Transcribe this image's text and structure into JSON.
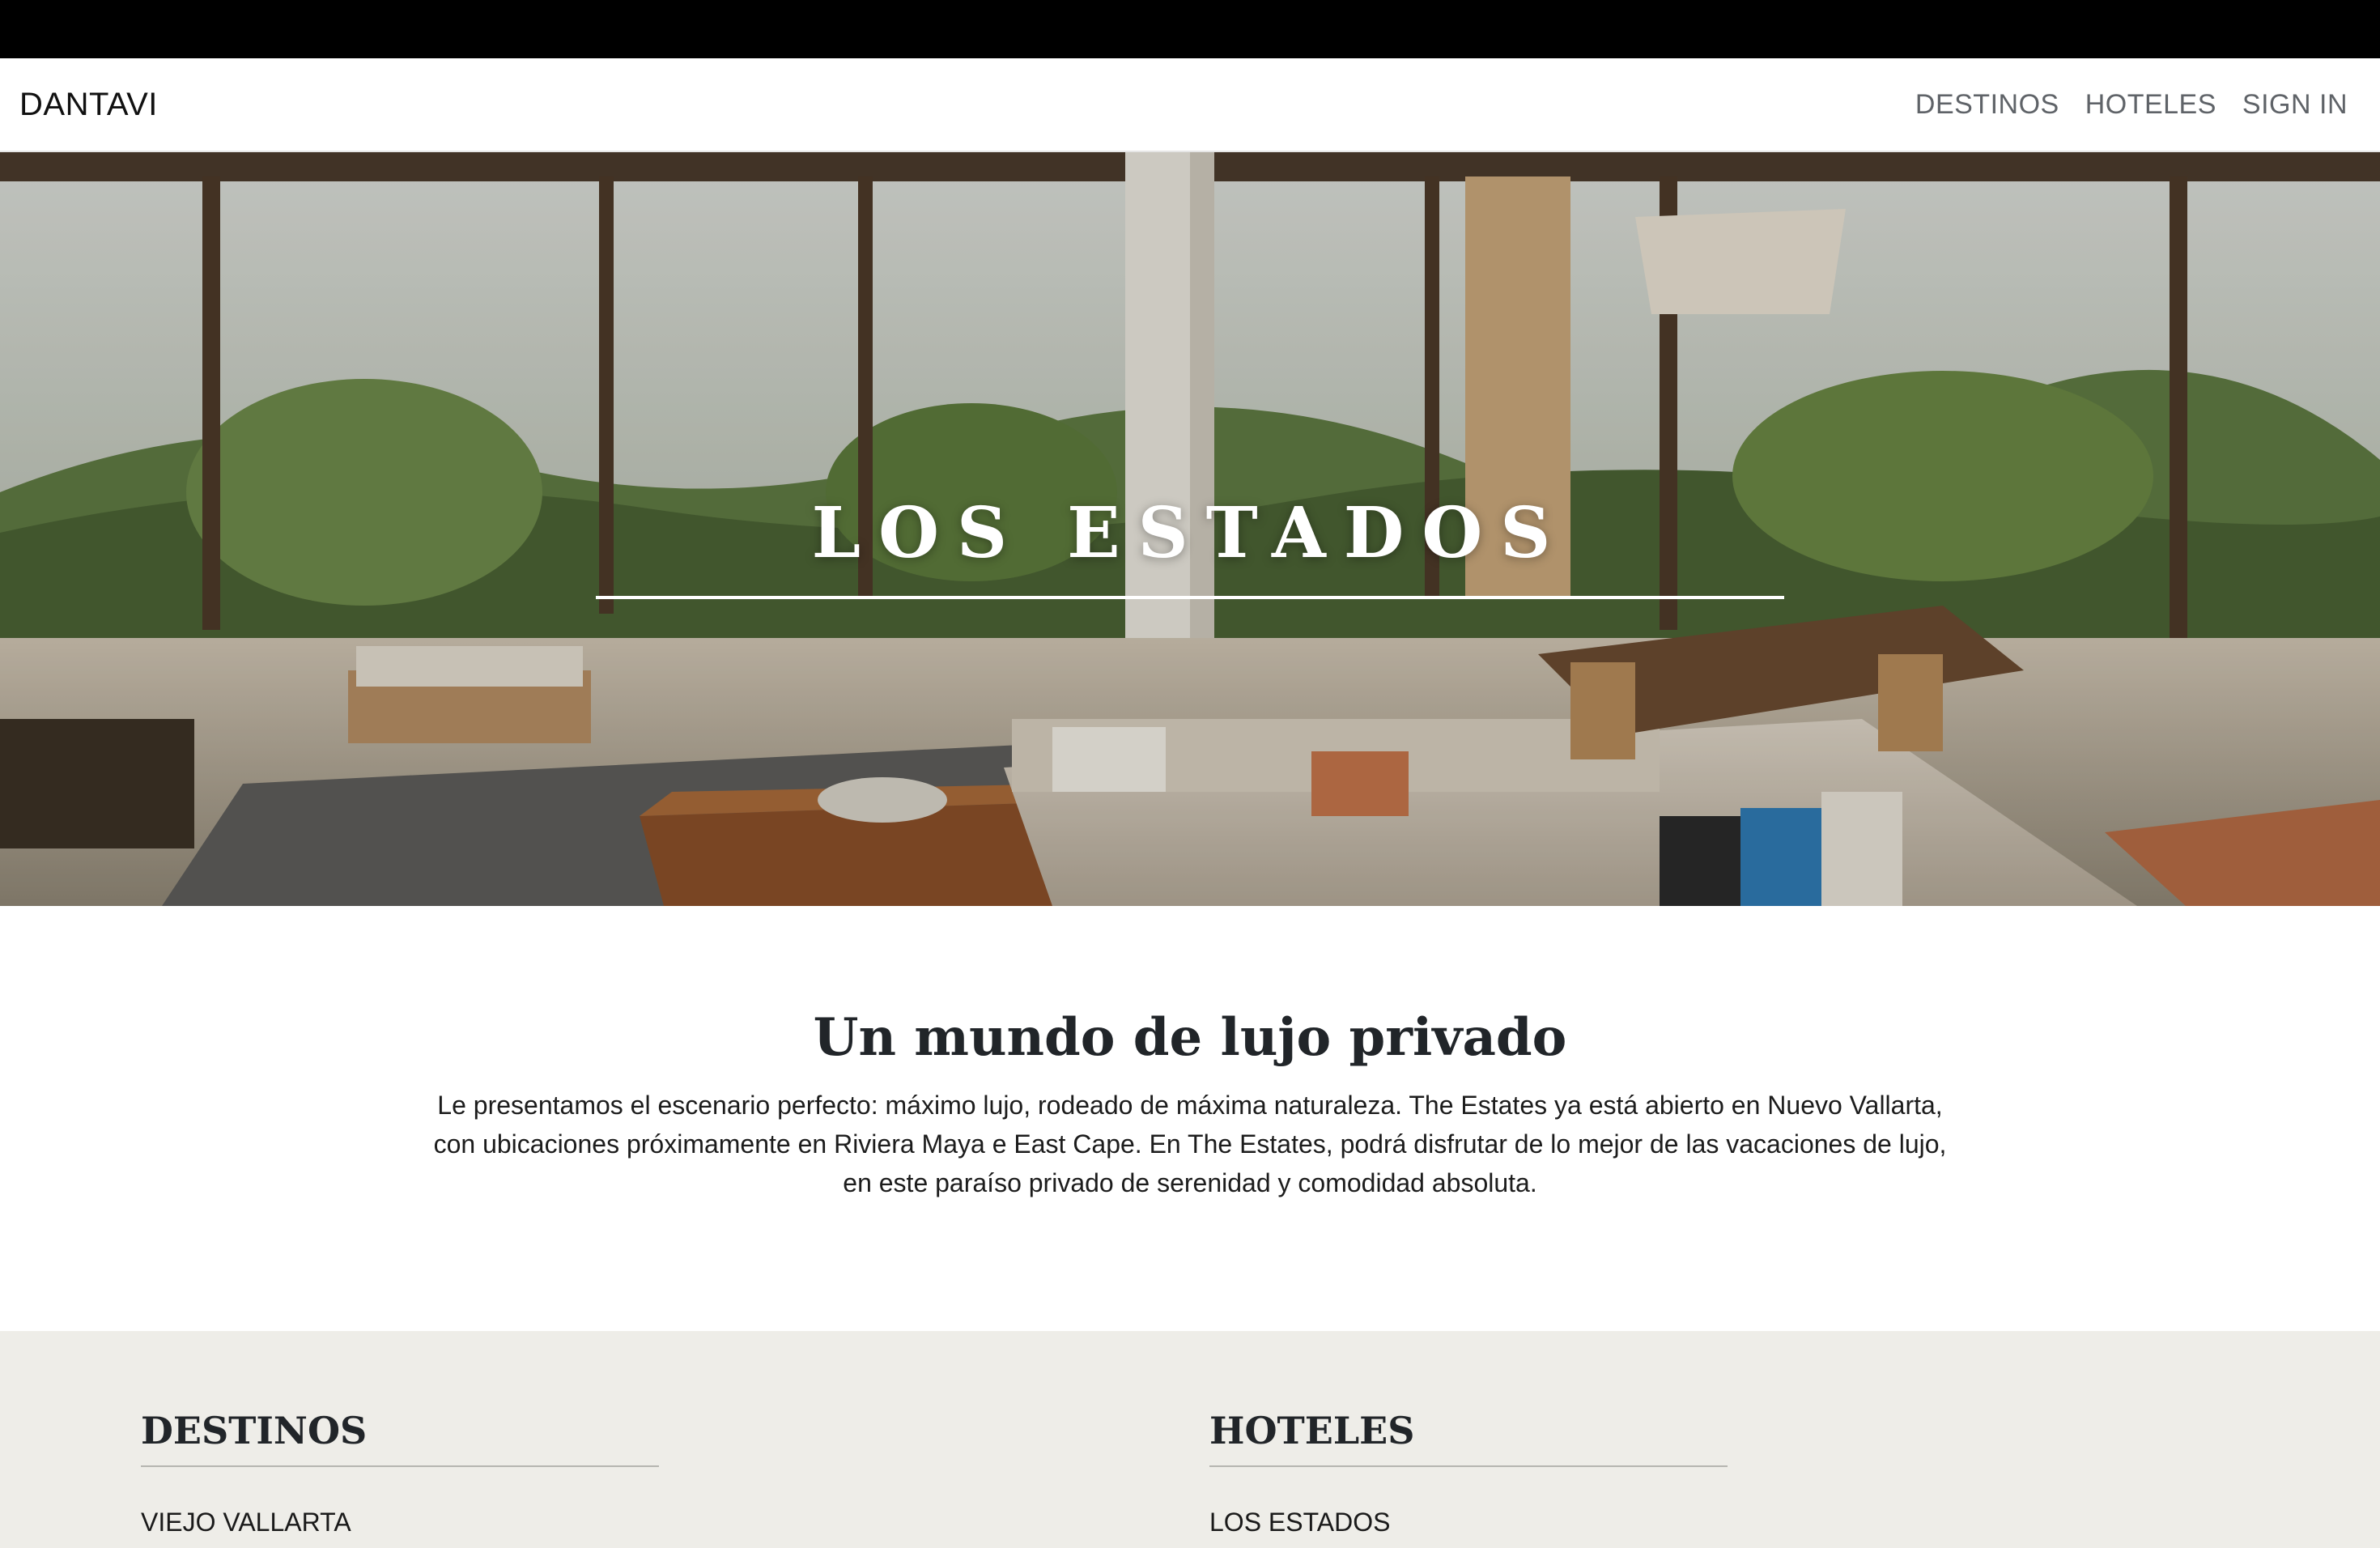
{
  "navbar": {
    "brand": "DANTAVI",
    "links": [
      "DESTINOS",
      "HOTELES",
      "SIGN IN"
    ]
  },
  "hero": {
    "title": "LOS ESTADOS"
  },
  "intro": {
    "heading": "Un mundo de lujo privado",
    "text": "Le presentamos el escenario perfecto: máximo lujo, rodeado de máxima naturaleza. The Estates ya está abierto en Nuevo Vallarta, con ubicaciones próximamente en Riviera Maya e East Cape. En The Estates, podrá disfrutar de lo mejor de las vacaciones de lujo, en este paraíso privado de serenidad y comodidad absoluta."
  },
  "footer": {
    "destinos": {
      "heading": "DESTINOS",
      "first_link": "VIEJO VALLARTA"
    },
    "hoteles": {
      "heading": "HOTELES",
      "first_link": "LOS ESTADOS"
    }
  },
  "colors": {
    "footer_bg": "#eeede8",
    "nav_link": "#5f6368",
    "top_bar": "#000000"
  }
}
